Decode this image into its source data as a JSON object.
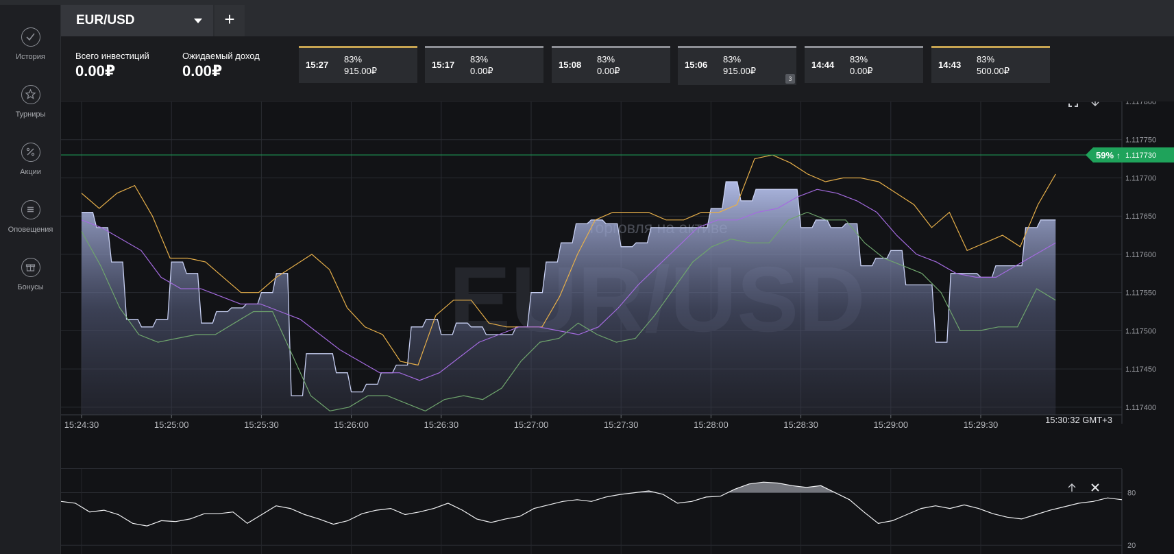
{
  "sidebar": {
    "items": [
      {
        "label": "История",
        "icon": "check-icon"
      },
      {
        "label": "Турниры",
        "icon": "star-icon"
      },
      {
        "label": "Акции",
        "icon": "percent-icon"
      },
      {
        "label": "Оповещения",
        "icon": "list-icon"
      },
      {
        "label": "Бонусы",
        "icon": "gift-icon"
      }
    ]
  },
  "header": {
    "asset": "EUR/USD",
    "add_label": "+"
  },
  "stats": {
    "total_label": "Всего инвестиций",
    "total_value": "0.00₽",
    "expected_label": "Ожидаемый доход",
    "expected_value": "0.00₽"
  },
  "deals": [
    {
      "time": "15:27",
      "pct": "83%",
      "amount": "915.00₽",
      "accent": "gold"
    },
    {
      "time": "15:17",
      "pct": "83%",
      "amount": "0.00₽",
      "accent": "gray"
    },
    {
      "time": "15:08",
      "pct": "83%",
      "amount": "0.00₽",
      "accent": "gray"
    },
    {
      "time": "15:06",
      "pct": "83%",
      "amount": "915.00₽",
      "accent": "gray",
      "badge": "3"
    },
    {
      "time": "14:44",
      "pct": "83%",
      "amount": "0.00₽",
      "accent": "gray"
    },
    {
      "time": "14:43",
      "pct": "83%",
      "amount": "500.00₽",
      "accent": "gold"
    }
  ],
  "colors": {
    "accent_green": "#1fa35b",
    "bollinger_upper": "#e8b04a",
    "bollinger_lower": "#6fa56d",
    "moving_average": "#a46be0",
    "price_area": "#a9b4e3"
  },
  "chart_data": [
    {
      "type": "area",
      "watermark": "EUR/USD",
      "watermark_sub": "Торговля на активе",
      "x_ticks": [
        "15:24:30",
        "15:25:00",
        "15:25:30",
        "15:26:00",
        "15:26:30",
        "15:27:00",
        "15:27:30",
        "15:28:00",
        "15:28:30",
        "15:29:00",
        "15:29:30"
      ],
      "y_ticks": [
        "1.117800",
        "1.117750",
        "1.117700",
        "1.117650",
        "1.117600",
        "1.117550",
        "1.117500",
        "1.117450",
        "1.117400"
      ],
      "ylim": [
        1.11739,
        1.1178
      ],
      "current_price": "1.117730",
      "current_price_value": 1.11773,
      "payout_label": "59%",
      "clock": "15:30:32 GMT+3",
      "t": [
        0,
        5,
        10,
        15,
        20,
        25,
        30,
        35,
        40,
        45,
        50,
        55,
        60,
        65,
        70,
        75,
        80,
        85,
        90,
        95,
        100,
        105,
        110,
        115,
        120,
        125,
        130,
        135,
        140,
        145,
        150,
        155,
        160,
        165,
        170,
        175,
        180,
        185,
        190,
        195,
        200,
        205,
        210,
        215,
        220,
        225,
        230,
        235,
        240,
        245,
        250,
        255,
        260,
        265,
        270,
        275,
        280,
        285,
        290,
        295,
        300,
        305,
        310,
        315,
        320,
        325
      ],
      "series": [
        {
          "name": "",
          "values": [
            1.117655,
            1.117635,
            1.11759,
            1.117515,
            1.117505,
            1.117515,
            1.11759,
            1.117575,
            1.11751,
            1.117525,
            1.11753,
            1.117535,
            1.11755,
            1.117575,
            1.117415,
            1.11747,
            1.11747,
            1.117445,
            1.11742,
            1.11743,
            1.117445,
            1.117455,
            1.117505,
            1.117515,
            1.117495,
            1.11751,
            1.117505,
            1.117495,
            1.117495,
            1.117505,
            1.11755,
            1.11759,
            1.117615,
            1.11764,
            1.117645,
            1.11764,
            1.11761,
            1.117615,
            1.117635,
            1.117635,
            1.117635,
            1.117635,
            1.11766,
            1.117695,
            1.11767,
            1.117685,
            1.117685,
            1.117685,
            1.117635,
            1.117645,
            1.117635,
            1.11764,
            1.117585,
            1.117595,
            1.117605,
            1.11756,
            1.11756,
            1.117485,
            1.117575,
            1.117575,
            1.11757,
            1.117585,
            1.117585,
            1.117635,
            1.117645,
            1.117645
          ]
        },
        {
          "name": "",
          "values": [
            1.11768,
            1.11766,
            1.11768,
            1.11769,
            1.11765,
            1.117595,
            1.117595,
            1.11759,
            1.11757,
            1.11755,
            1.11755,
            1.11757,
            1.117585,
            1.1176,
            1.11758,
            1.11753,
            1.117505,
            1.117495,
            1.11746,
            1.117455,
            1.11752,
            1.11754,
            1.11754,
            1.11751,
            1.117505,
            1.117505,
            1.117505,
            1.117545,
            1.1176,
            1.117645,
            1.117655,
            1.117655,
            1.117655,
            1.117645,
            1.117645,
            1.117655,
            1.117655,
            1.117665,
            1.117725,
            1.11773,
            1.11772,
            1.117705,
            1.117695,
            1.1177,
            1.1177,
            1.117695,
            1.11768,
            1.117665,
            1.117635,
            1.117655,
            1.117605,
            1.117615,
            1.117625,
            1.11761,
            1.117665,
            1.117705
          ]
        },
        {
          "name": "",
          "values": [
            1.117645,
            1.117635,
            1.11762,
            1.117605,
            1.11757,
            1.117555,
            1.117555,
            1.117545,
            1.117535,
            1.117535,
            1.117525,
            1.117515,
            1.117495,
            1.117475,
            1.11746,
            1.117445,
            1.117445,
            1.117435,
            1.117445,
            1.117465,
            1.117485,
            1.117495,
            1.117505,
            1.117505,
            1.1175,
            1.117495,
            1.117505,
            1.11753,
            1.11756,
            1.117585,
            1.11761,
            1.117635,
            1.117645,
            1.117645,
            1.117655,
            1.11766,
            1.117675,
            1.117685,
            1.11768,
            1.11767,
            1.117655,
            1.117625,
            1.1176,
            1.11759,
            1.117575,
            1.11757,
            1.11757,
            1.117585,
            1.1176,
            1.117615
          ]
        },
        {
          "name": "",
          "values": [
            1.11763,
            1.117585,
            1.11753,
            1.117495,
            1.117485,
            1.11749,
            1.117495,
            1.117495,
            1.11751,
            1.117525,
            1.117525,
            1.11747,
            1.117415,
            1.117395,
            1.1174,
            1.117415,
            1.117415,
            1.117405,
            1.117395,
            1.11741,
            1.117415,
            1.11741,
            1.117425,
            1.11746,
            1.117485,
            1.11749,
            1.11751,
            1.117495,
            1.117485,
            1.11749,
            1.11752,
            1.117555,
            1.11759,
            1.11761,
            1.11762,
            1.117615,
            1.117615,
            1.117645,
            1.117655,
            1.117645,
            1.117645,
            1.117615,
            1.117595,
            1.117585,
            1.117575,
            1.11755,
            1.1175,
            1.1175,
            1.117505,
            1.117505,
            1.117555,
            1.11754
          ]
        }
      ]
    },
    {
      "type": "line",
      "indicator": "oscillator",
      "y_ticks": [
        "80",
        "20"
      ],
      "ylim": [
        10,
        100
      ],
      "values": [
        70,
        68,
        58,
        60,
        55,
        45,
        42,
        48,
        47,
        50,
        56,
        56,
        58,
        45,
        55,
        65,
        62,
        55,
        50,
        44,
        48,
        56,
        60,
        62,
        55,
        58,
        62,
        68,
        60,
        50,
        46,
        50,
        53,
        62,
        66,
        70,
        72,
        70,
        75,
        78,
        80,
        82,
        78,
        68,
        70,
        75,
        76,
        84,
        90,
        92,
        91,
        88,
        86,
        88,
        80,
        72,
        58,
        45,
        48,
        55,
        62,
        65,
        62,
        66,
        62,
        56,
        52,
        50,
        55,
        60,
        64,
        68,
        70,
        74,
        72
      ]
    }
  ]
}
